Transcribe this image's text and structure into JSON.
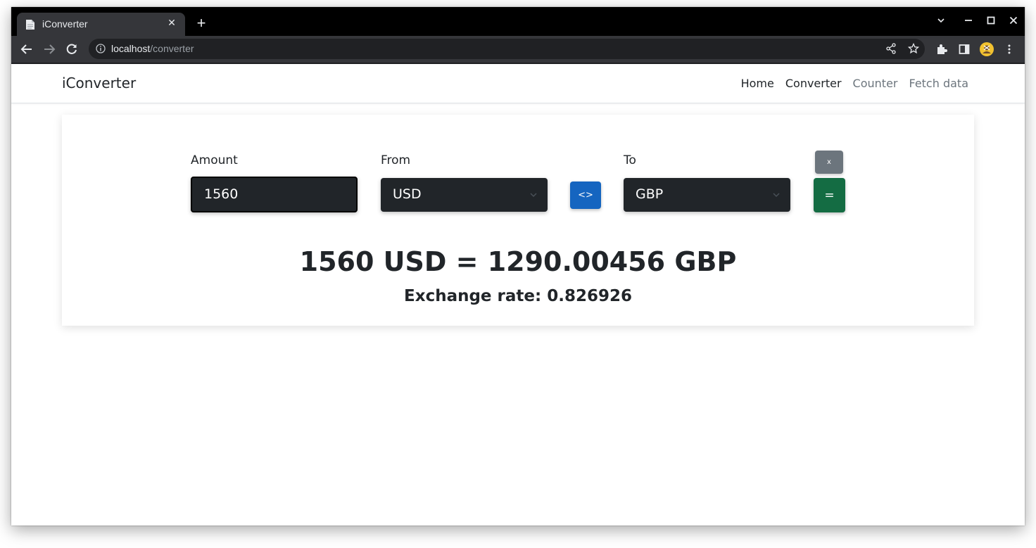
{
  "browser": {
    "tab_title": "iConverter",
    "tab_close": "✕",
    "new_tab": "+",
    "url_host": "localhost",
    "url_path": "/converter"
  },
  "navbar": {
    "brand": "iConverter",
    "links": [
      {
        "label": "Home",
        "active": true
      },
      {
        "label": "Converter",
        "active": true
      },
      {
        "label": "Counter",
        "active": false
      },
      {
        "label": "Fetch data",
        "active": false
      }
    ]
  },
  "converter": {
    "amount_label": "Amount",
    "amount_value": "1560",
    "from_label": "From",
    "from_value": "USD",
    "to_label": "To",
    "to_value": "GBP",
    "swap_label": "<>",
    "clear_label": "x",
    "convert_label": "="
  },
  "result": {
    "conversion": "1560 USD = 1290.00456 GBP",
    "exchange_rate": "Exchange rate: 0.826926"
  },
  "colors": {
    "swap_button": "#1565c0",
    "clear_button": "#6c757d",
    "convert_button": "#146c43",
    "input_background": "#212529"
  }
}
